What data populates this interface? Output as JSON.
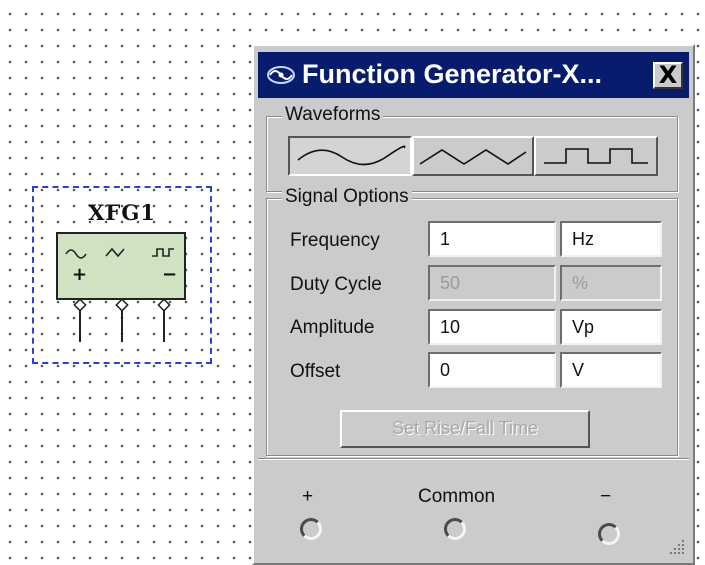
{
  "component": {
    "label": "XFG1",
    "pins": [
      "+",
      "−"
    ],
    "icons": [
      "sine-wave-icon",
      "triangle-wave-icon",
      "square-wave-icon"
    ]
  },
  "window": {
    "title": "Function Generator-X...",
    "close_label": "X",
    "waveforms": {
      "label": "Waveforms",
      "buttons": [
        {
          "name": "sine",
          "icon": "sine-wave-icon",
          "pressed": true
        },
        {
          "name": "triangle",
          "icon": "triangle-wave-icon",
          "pressed": false
        },
        {
          "name": "square",
          "icon": "square-wave-icon",
          "pressed": false
        }
      ]
    },
    "signal_options": {
      "label": "Signal Options",
      "rows": [
        {
          "label": "Frequency",
          "value": "1",
          "unit": "Hz",
          "enabled": true
        },
        {
          "label": "Duty Cycle",
          "value": "50",
          "unit": "%",
          "enabled": false
        },
        {
          "label": "Amplitude",
          "value": "10",
          "unit": "Vp",
          "enabled": true
        },
        {
          "label": "Offset",
          "value": "0",
          "unit": "V",
          "enabled": true
        }
      ],
      "rise_fall_button": "Set Rise/Fall Time"
    },
    "terminals": {
      "plus": "+",
      "common": "Common",
      "minus": "−"
    }
  },
  "colors": {
    "title_bar": "#081c6e",
    "window_bg": "#cbcbcb",
    "selection": "#2b3fe0",
    "component_body": "#cfe3c3"
  }
}
